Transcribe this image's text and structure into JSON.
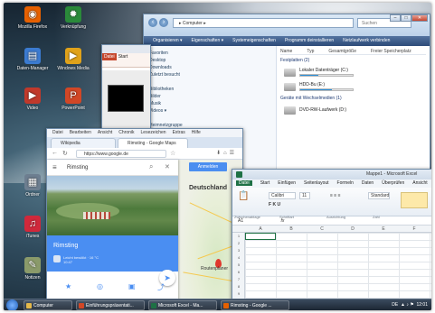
{
  "desktop": {
    "icons": [
      {
        "label": "Mozilla Firefox",
        "icon": "firefox-icon",
        "color": "#e66000"
      },
      {
        "label": "Verknüpfung",
        "icon": "gear-icon",
        "color": "#2a8a3a"
      },
      {
        "label": "Daten-Manager",
        "icon": "server-icon",
        "color": "#3b7bd1"
      },
      {
        "label": "Windows Media",
        "icon": "media-icon",
        "color": "#e0a21a"
      },
      {
        "label": "Video",
        "icon": "video-icon",
        "color": "#c0392b"
      },
      {
        "label": "PowerPoint",
        "icon": "powerpoint-icon",
        "color": "#d24726"
      },
      {
        "label": "Ordner",
        "icon": "folder-icon",
        "color": "#6d7e90"
      },
      {
        "label": "iTunes",
        "icon": "music-icon",
        "color": "#d0283b"
      },
      {
        "label": "Notizen",
        "icon": "document-icon",
        "color": "#8a9a6a"
      }
    ]
  },
  "explorer": {
    "address": "▸ Computer ▸",
    "search_placeholder": "Suchen",
    "toolbar": [
      "Organisieren ▾",
      "Eigenschaften ▾",
      "Systemeigenschaften",
      "Programm deinstallieren",
      "Netzlaufwerk verbinden"
    ],
    "nav": [
      "Favoriten",
      "Desktop",
      "Downloads",
      "Zuletzt besucht",
      "",
      "Bibliotheken",
      "Bilder",
      "Musik",
      "Videos ▾",
      "",
      "Heimnetzgruppe",
      "Computer",
      "Lokaler Datenträger (C:)",
      "DVD-RW-Laufwerk (D:)"
    ],
    "columns": [
      "Name",
      "Typ",
      "Gesamtgröße",
      "Freier Speicherplatz"
    ],
    "group_drives": "Festplatten (2)",
    "group_removable": "Geräte mit Wechselmedien (1)",
    "drives": [
      {
        "name": "Lokaler Datenträger (C:)",
        "fill": 0.35
      },
      {
        "name": "HDD-Bu (E:)",
        "fill": 0.6
      }
    ],
    "removable": "DVD-RW-Laufwerk (D:)"
  },
  "powerpoint": {
    "tabs": [
      "Datei",
      "Start"
    ]
  },
  "chrome": {
    "menu": [
      "Datei",
      "Bearbeiten",
      "Ansicht",
      "Chronik",
      "Lesezeichen",
      "Extras",
      "Hilfe"
    ],
    "tabs": [
      "Wikipedia",
      "Rimsting - Google Maps"
    ],
    "url": "https://www.google.de",
    "search_query": "Rimsting",
    "signin": "Anmelden",
    "map_country": "Deutschland",
    "card_title": "Rimsting",
    "card_sub": "Leicht bewölkt · 16 °C",
    "card_time": "10:47",
    "routes": "Routenplaner"
  },
  "excel": {
    "title": "Mappe1 - Microsoft Excel",
    "tabs": [
      "Datei",
      "Start",
      "Einfügen",
      "Seitenlayout",
      "Formeln",
      "Daten",
      "Überprüfen",
      "Ansicht"
    ],
    "font_name": "Calibri",
    "font_size": "11",
    "number_format": "Standard",
    "groups": [
      "Zwischenablage",
      "Schriftart",
      "Ausrichtung",
      "Zahl",
      "Formatvorlagen"
    ],
    "cell_ref": "A1",
    "formula_label": "fx",
    "columns": [
      "A",
      "B",
      "C",
      "D",
      "E",
      "F",
      "G"
    ],
    "rows": [
      "1",
      "2",
      "3",
      "4",
      "5",
      "6",
      "7",
      "8",
      "9",
      "10"
    ]
  },
  "taskbar": {
    "items": [
      {
        "label": "Computer",
        "color": "#e4b84a"
      },
      {
        "label": "Einführungspräsentati...",
        "color": "#d24726"
      },
      {
        "label": "Microsoft Excel - Ma...",
        "color": "#1e7145"
      },
      {
        "label": "Rimsting - Google ...",
        "color": "#e66000"
      }
    ],
    "tray_lang": "DE",
    "tray_time": "12:01"
  }
}
